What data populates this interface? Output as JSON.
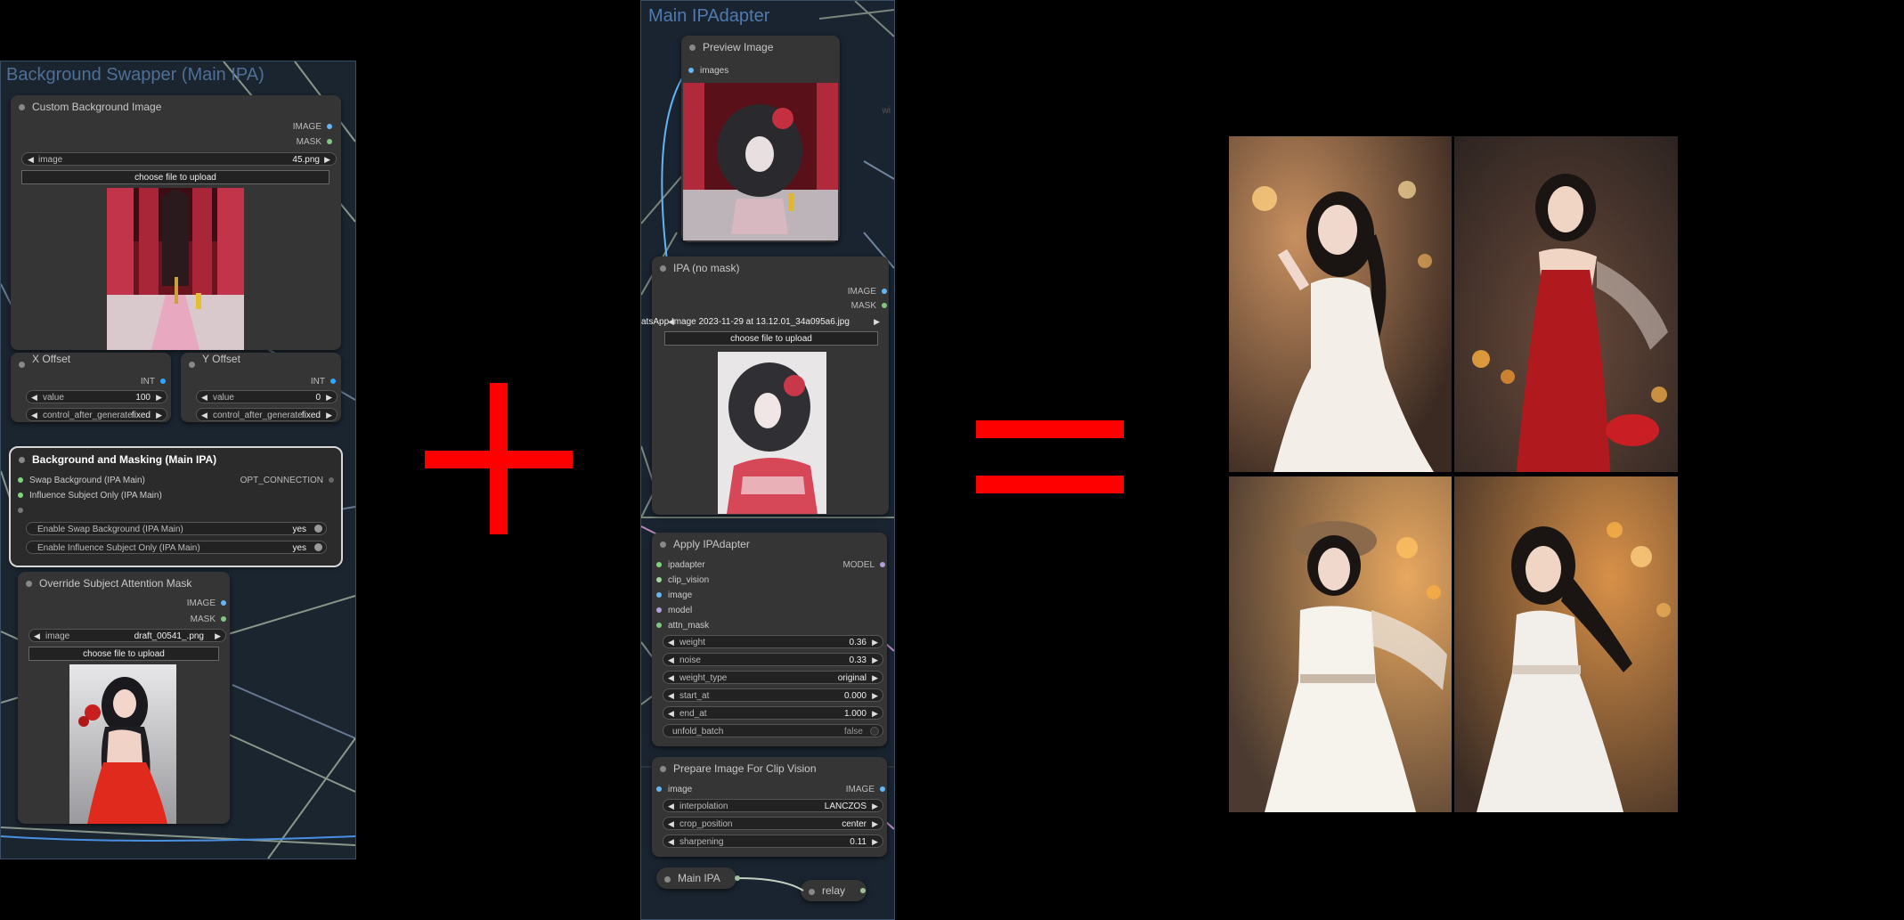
{
  "colors": {
    "plus": "#ff0000",
    "link_image": "#64b5f6",
    "link_mask": "#81c784",
    "link_model": "#b39ddb",
    "link_int": "#29a9ff",
    "link_opt": "#666666"
  },
  "left_group": {
    "title": "Background Swapper (Main IPA)",
    "custom_bg": {
      "title": "Custom Background Image",
      "out_image": "IMAGE",
      "out_mask": "MASK",
      "image_label": "image",
      "image_value": "45.png",
      "upload": "choose file to upload"
    },
    "x_offset": {
      "title": "X Offset",
      "out": "INT",
      "value_label": "value",
      "value": "100",
      "control_label": "control_after_generate",
      "control_value": "fixed"
    },
    "y_offset": {
      "title": "Y Offset",
      "out": "INT",
      "value_label": "value",
      "value": "0",
      "control_label": "control_after_generate",
      "control_value": "fixed"
    }
  },
  "bg_masking": {
    "title": "Background and Masking (Main IPA)",
    "in_swap": "Swap Background (IPA Main)",
    "in_influence": "Influence Subject Only (IPA Main)",
    "out": "OPT_CONNECTION",
    "toggle_swap_label": "Enable Swap Background (IPA Main)",
    "toggle_swap_value": "yes",
    "toggle_influence_label": "Enable Influence Subject Only (IPA Main)",
    "toggle_influence_value": "yes"
  },
  "override_mask": {
    "title": "Override Subject Attention Mask",
    "out_image": "IMAGE",
    "out_mask": "MASK",
    "image_label": "image",
    "image_value": "draft_00541_.png",
    "upload": "choose file to upload"
  },
  "main_group": {
    "title": "Main IPAdapter",
    "side_hint": "wi",
    "preview": {
      "title": "Preview Image",
      "in": "images"
    },
    "ipa_no_mask": {
      "title": "IPA (no mask)",
      "out_image": "IMAGE",
      "out_mask": "MASK",
      "image_value": "atsApp Image 2023-11-29 at 13.12.01_34a095a6.jpg",
      "upload": "choose file to upload"
    },
    "apply": {
      "title": "Apply IPAdapter",
      "inputs": [
        "ipadapter",
        "clip_vision",
        "image",
        "model",
        "attn_mask"
      ],
      "out": "MODEL",
      "widgets": [
        {
          "label": "weight",
          "value": "0.36"
        },
        {
          "label": "noise",
          "value": "0.33"
        },
        {
          "label": "weight_type",
          "value": "original"
        },
        {
          "label": "start_at",
          "value": "0.000"
        },
        {
          "label": "end_at",
          "value": "1.000"
        }
      ],
      "toggle_label": "unfold_batch",
      "toggle_value": "false"
    },
    "prepare": {
      "title": "Prepare Image For Clip Vision",
      "in": "image",
      "out": "IMAGE",
      "widgets": [
        {
          "label": "interpolation",
          "value": "LANCZOS"
        },
        {
          "label": "crop_position",
          "value": "center"
        },
        {
          "label": "sharpening",
          "value": "0.11"
        }
      ]
    },
    "main_ipa": "Main IPA",
    "relay": "relay"
  }
}
